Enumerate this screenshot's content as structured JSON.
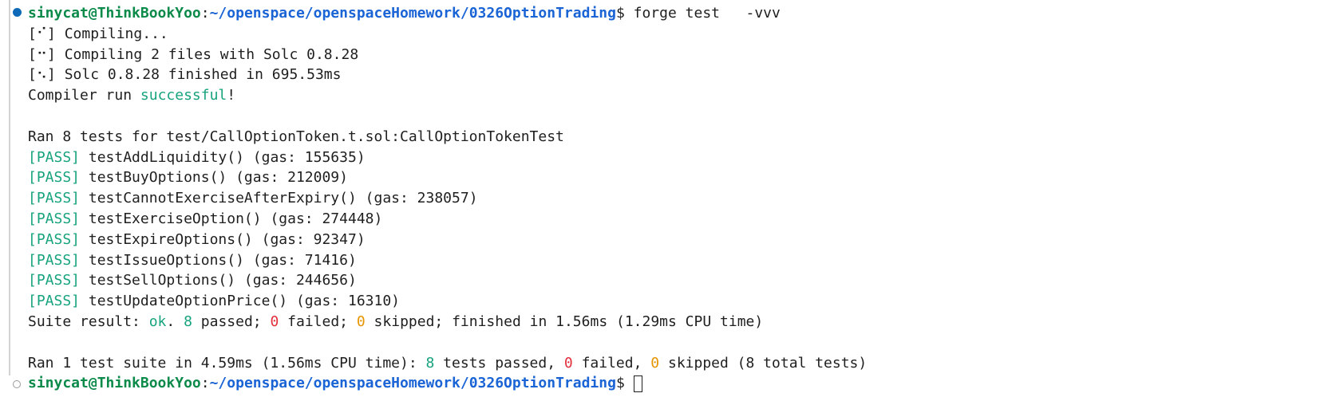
{
  "prompt": {
    "user": "sinycat@ThinkBookYoo",
    "colon": ":",
    "path": "~/openspace/openspaceHomework/0326OptionTrading",
    "dollar": "$ ",
    "command": "forge test   -vvv"
  },
  "compile": [
    {
      "spinner": "[⠊]",
      "text": " Compiling..."
    },
    {
      "spinner": "[⠒]",
      "text": " Compiling 2 files with Solc 0.8.28"
    },
    {
      "spinner": "[⠢]",
      "text": " Solc 0.8.28 finished in 695.53ms"
    }
  ],
  "compiler_result": {
    "prefix": "Compiler run ",
    "status": "successful",
    "suffix": "!"
  },
  "suite_header": "Ran 8 tests for test/CallOptionToken.t.sol:CallOptionTokenTest",
  "tests": [
    {
      "status": "[PASS]",
      "name": " testAddLiquidity() (gas: 155635)"
    },
    {
      "status": "[PASS]",
      "name": " testBuyOptions() (gas: 212009)"
    },
    {
      "status": "[PASS]",
      "name": " testCannotExerciseAfterExpiry() (gas: 238057)"
    },
    {
      "status": "[PASS]",
      "name": " testExerciseOption() (gas: 274448)"
    },
    {
      "status": "[PASS]",
      "name": " testExpireOptions() (gas: 92347)"
    },
    {
      "status": "[PASS]",
      "name": " testIssueOptions() (gas: 71416)"
    },
    {
      "status": "[PASS]",
      "name": " testSellOptions() (gas: 244656)"
    },
    {
      "status": "[PASS]",
      "name": " testUpdateOptionPrice() (gas: 16310)"
    }
  ],
  "suite_result": {
    "prefix": "Suite result: ",
    "ok": "ok",
    "p1": ". ",
    "passed_n": "8",
    "p2": " passed; ",
    "failed_n": "0",
    "p3": " failed; ",
    "skipped_n": "0",
    "p4": " skipped; finished in 1.56ms (1.29ms CPU time)"
  },
  "summary": {
    "prefix": "Ran 1 test suite in 4.59ms (1.56ms CPU time): ",
    "passed_n": "8",
    "p1": " tests passed, ",
    "failed_n": "0",
    "p2": " failed, ",
    "skipped_n": "0",
    "p3": " skipped (8 total tests)"
  },
  "prompt2": {
    "user": "sinycat@ThinkBookYoo",
    "colon": ":",
    "path": "~/openspace/openspaceHomework/0326OptionTrading",
    "dollar": "$ "
  }
}
